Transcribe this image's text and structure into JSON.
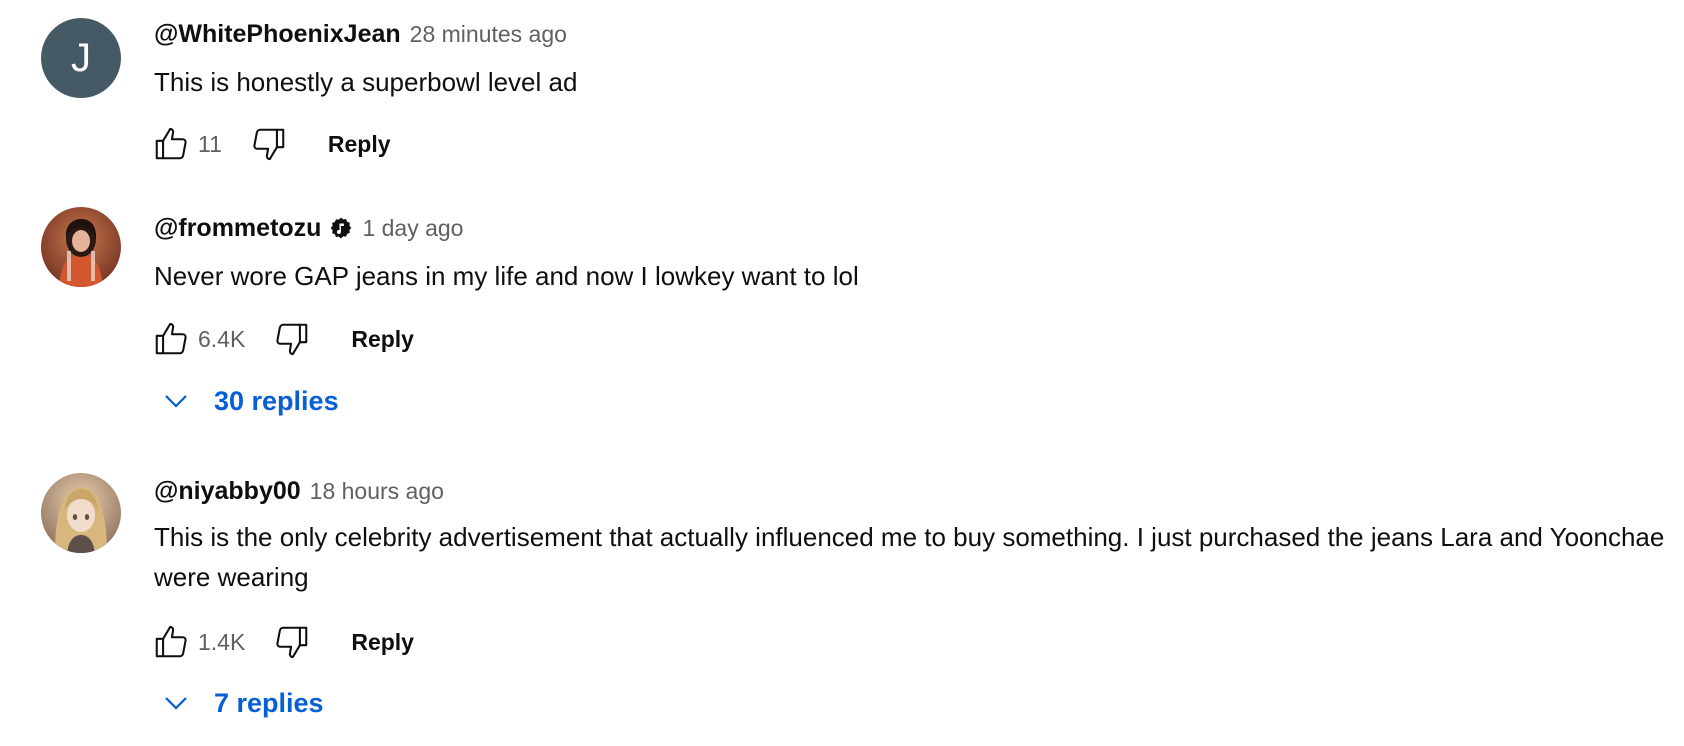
{
  "comments": [
    {
      "avatar_letter": "J",
      "avatar_color": "#455a64",
      "author": "@WhitePhoenixJean",
      "verified": false,
      "timestamp": "28 minutes ago",
      "text": "This is honestly a superbowl level ad",
      "likes": "11",
      "reply_label": "Reply"
    },
    {
      "avatar_letter": "",
      "author": "@frommetozu",
      "verified": true,
      "verified_icon": "music-note-badge-icon",
      "timestamp": "1 day ago",
      "text": "Never wore GAP jeans in my life and now I lowkey want to lol",
      "likes": "6.4K",
      "reply_label": "Reply",
      "replies_label": "30 replies"
    },
    {
      "avatar_letter": "",
      "author": "@niyabby00",
      "verified": false,
      "timestamp": "18 hours ago",
      "text": "This is the only celebrity advertisement that actually influenced me to buy something. I just purchased the jeans Lara and Yoonchae were wearing",
      "likes": "1.4K",
      "reply_label": "Reply",
      "replies_label": "7 replies"
    }
  ],
  "icons": {
    "like": "thumbs-up-icon",
    "dislike": "thumbs-down-icon",
    "expand": "chevron-down-icon"
  },
  "colors": {
    "link_blue": "#065fd4",
    "secondary_text": "#606060",
    "primary_text": "#0f0f0f"
  }
}
